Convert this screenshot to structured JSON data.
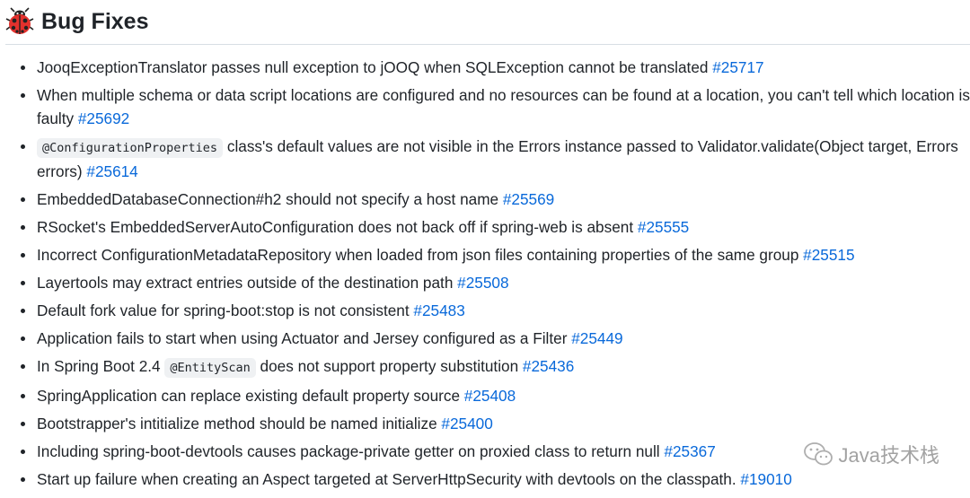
{
  "heading": {
    "title": "Bug Fixes",
    "icon": "ladybug-icon"
  },
  "items": [
    {
      "pre": "JooqExceptionTranslator passes null exception to jOOQ when SQLException cannot be translated ",
      "code": "",
      "post": "",
      "issue": "#25717"
    },
    {
      "pre": "When multiple schema or data script locations are configured and no resources can be found at a location, you can't tell which location is faulty ",
      "code": "",
      "post": "",
      "issue": "#25692"
    },
    {
      "pre": "",
      "code": "@ConfigurationProperties",
      "post": " class's default values are not visible in the Errors instance passed to Validator.validate(Object target, Errors errors) ",
      "issue": "#25614"
    },
    {
      "pre": "EmbeddedDatabaseConnection#h2 should not specify a host name ",
      "code": "",
      "post": "",
      "issue": "#25569"
    },
    {
      "pre": "RSocket's EmbeddedServerAutoConfiguration does not back off if spring-web is absent ",
      "code": "",
      "post": "",
      "issue": "#25555"
    },
    {
      "pre": "Incorrect ConfigurationMetadataRepository when loaded from json files containing properties of the same group ",
      "code": "",
      "post": "",
      "issue": "#25515"
    },
    {
      "pre": "Layertools may extract entries outside of the destination path ",
      "code": "",
      "post": "",
      "issue": "#25508"
    },
    {
      "pre": "Default fork value for spring-boot:stop is not consistent ",
      "code": "",
      "post": "",
      "issue": "#25483"
    },
    {
      "pre": "Application fails to start when using Actuator and Jersey configured as a Filter ",
      "code": "",
      "post": "",
      "issue": "#25449"
    },
    {
      "pre": "In Spring Boot 2.4 ",
      "code": "@EntityScan",
      "post": " does not support property substitution ",
      "issue": "#25436"
    },
    {
      "pre": "SpringApplication can replace existing default property source ",
      "code": "",
      "post": "",
      "issue": "#25408"
    },
    {
      "pre": "Bootstrapper's intitialize method should be named initialize ",
      "code": "",
      "post": "",
      "issue": "#25400"
    },
    {
      "pre": "Including spring-boot-devtools causes package-private getter on proxied class to return null ",
      "code": "",
      "post": "",
      "issue": "#25367"
    },
    {
      "pre": "Start up failure when creating an Aspect targeted at ServerHttpSecurity with devtools on the classpath. ",
      "code": "",
      "post": "",
      "issue": "#19010"
    }
  ],
  "watermark": {
    "text": "Java技术栈",
    "icon": "wechat-icon"
  },
  "colors": {
    "link": "#0969da",
    "text": "#1f2328",
    "code_bg": "#eff1f3"
  }
}
